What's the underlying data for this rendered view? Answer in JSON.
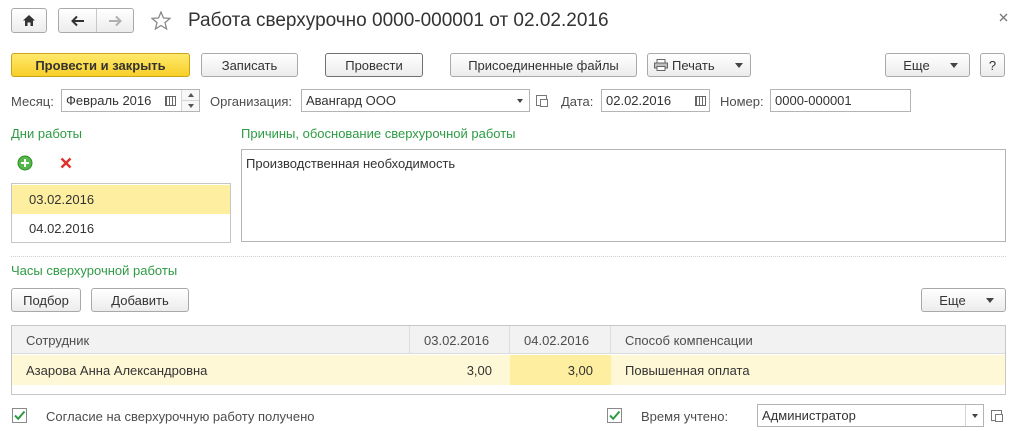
{
  "window": {
    "title": "Работа сверхурочно 0000-000001 от 02.02.2016"
  },
  "toolbar": {
    "post_close_label": "Провести и закрыть",
    "save_label": "Записать",
    "post_label": "Провести",
    "attached_files_label": "Присоединенные файлы",
    "print_label": "Печать",
    "more_label": "Еще",
    "help_label": "?"
  },
  "header_fields": {
    "month_label": "Месяц:",
    "month_value": "Февраль 2016",
    "organization_label": "Организация:",
    "organization_value": "Авангард ООО",
    "date_label": "Дата:",
    "date_value": "02.02.2016",
    "number_label": "Номер:",
    "number_value": "0000-000001"
  },
  "work_days": {
    "title": "Дни работы",
    "items": [
      "03.02.2016",
      "04.02.2016"
    ],
    "selected_index": 0
  },
  "reasons": {
    "title": "Причины, обоснование сверхурочной работы",
    "text": "Производственная необходимость"
  },
  "overtime_hours": {
    "title": "Часы сверхурочной работы",
    "select_label": "Подбор",
    "add_label": "Добавить",
    "more_label": "Еще",
    "columns": [
      "Сотрудник",
      "03.02.2016",
      "04.02.2016",
      "Способ компенсации"
    ],
    "rows": [
      {
        "employee": "Азарова Анна Александровна",
        "day1": "3,00",
        "day2": "3,00",
        "compensation": "Повышенная оплата"
      }
    ]
  },
  "footer": {
    "consent_label": "Согласие на сверхурочную работу получено",
    "consent_checked": true,
    "time_accounted_label": "Время учтено:",
    "time_accounted_checked": true,
    "responsible_value": "Администратор"
  },
  "colors": {
    "accent_green": "#2e9b44",
    "primary_yellow": "#f8cf2a",
    "selection_yellow": "#fdeea0",
    "row_yellow": "#fff8d6"
  },
  "icons": {
    "home": "home-icon",
    "back": "arrow-left-icon",
    "forward": "arrow-right-icon",
    "favorite": "star-icon",
    "close": "close-icon",
    "print": "printer-icon",
    "add": "plus-circle-icon",
    "delete": "red-x-icon",
    "calendar": "calendar-icon",
    "open": "open-form-icon"
  }
}
